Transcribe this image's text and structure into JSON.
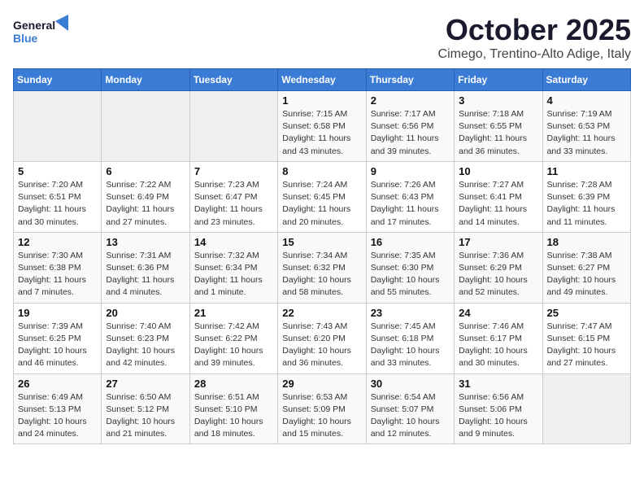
{
  "header": {
    "logo_general": "General",
    "logo_blue": "Blue",
    "title": "October 2025",
    "subtitle": "Cimego, Trentino-Alto Adige, Italy"
  },
  "weekdays": [
    "Sunday",
    "Monday",
    "Tuesday",
    "Wednesday",
    "Thursday",
    "Friday",
    "Saturday"
  ],
  "weeks": [
    [
      {
        "day": "",
        "info": ""
      },
      {
        "day": "",
        "info": ""
      },
      {
        "day": "",
        "info": ""
      },
      {
        "day": "1",
        "info": "Sunrise: 7:15 AM\nSunset: 6:58 PM\nDaylight: 11 hours and 43 minutes."
      },
      {
        "day": "2",
        "info": "Sunrise: 7:17 AM\nSunset: 6:56 PM\nDaylight: 11 hours and 39 minutes."
      },
      {
        "day": "3",
        "info": "Sunrise: 7:18 AM\nSunset: 6:55 PM\nDaylight: 11 hours and 36 minutes."
      },
      {
        "day": "4",
        "info": "Sunrise: 7:19 AM\nSunset: 6:53 PM\nDaylight: 11 hours and 33 minutes."
      }
    ],
    [
      {
        "day": "5",
        "info": "Sunrise: 7:20 AM\nSunset: 6:51 PM\nDaylight: 11 hours and 30 minutes."
      },
      {
        "day": "6",
        "info": "Sunrise: 7:22 AM\nSunset: 6:49 PM\nDaylight: 11 hours and 27 minutes."
      },
      {
        "day": "7",
        "info": "Sunrise: 7:23 AM\nSunset: 6:47 PM\nDaylight: 11 hours and 23 minutes."
      },
      {
        "day": "8",
        "info": "Sunrise: 7:24 AM\nSunset: 6:45 PM\nDaylight: 11 hours and 20 minutes."
      },
      {
        "day": "9",
        "info": "Sunrise: 7:26 AM\nSunset: 6:43 PM\nDaylight: 11 hours and 17 minutes."
      },
      {
        "day": "10",
        "info": "Sunrise: 7:27 AM\nSunset: 6:41 PM\nDaylight: 11 hours and 14 minutes."
      },
      {
        "day": "11",
        "info": "Sunrise: 7:28 AM\nSunset: 6:39 PM\nDaylight: 11 hours and 11 minutes."
      }
    ],
    [
      {
        "day": "12",
        "info": "Sunrise: 7:30 AM\nSunset: 6:38 PM\nDaylight: 11 hours and 7 minutes."
      },
      {
        "day": "13",
        "info": "Sunrise: 7:31 AM\nSunset: 6:36 PM\nDaylight: 11 hours and 4 minutes."
      },
      {
        "day": "14",
        "info": "Sunrise: 7:32 AM\nSunset: 6:34 PM\nDaylight: 11 hours and 1 minute."
      },
      {
        "day": "15",
        "info": "Sunrise: 7:34 AM\nSunset: 6:32 PM\nDaylight: 10 hours and 58 minutes."
      },
      {
        "day": "16",
        "info": "Sunrise: 7:35 AM\nSunset: 6:30 PM\nDaylight: 10 hours and 55 minutes."
      },
      {
        "day": "17",
        "info": "Sunrise: 7:36 AM\nSunset: 6:29 PM\nDaylight: 10 hours and 52 minutes."
      },
      {
        "day": "18",
        "info": "Sunrise: 7:38 AM\nSunset: 6:27 PM\nDaylight: 10 hours and 49 minutes."
      }
    ],
    [
      {
        "day": "19",
        "info": "Sunrise: 7:39 AM\nSunset: 6:25 PM\nDaylight: 10 hours and 46 minutes."
      },
      {
        "day": "20",
        "info": "Sunrise: 7:40 AM\nSunset: 6:23 PM\nDaylight: 10 hours and 42 minutes."
      },
      {
        "day": "21",
        "info": "Sunrise: 7:42 AM\nSunset: 6:22 PM\nDaylight: 10 hours and 39 minutes."
      },
      {
        "day": "22",
        "info": "Sunrise: 7:43 AM\nSunset: 6:20 PM\nDaylight: 10 hours and 36 minutes."
      },
      {
        "day": "23",
        "info": "Sunrise: 7:45 AM\nSunset: 6:18 PM\nDaylight: 10 hours and 33 minutes."
      },
      {
        "day": "24",
        "info": "Sunrise: 7:46 AM\nSunset: 6:17 PM\nDaylight: 10 hours and 30 minutes."
      },
      {
        "day": "25",
        "info": "Sunrise: 7:47 AM\nSunset: 6:15 PM\nDaylight: 10 hours and 27 minutes."
      }
    ],
    [
      {
        "day": "26",
        "info": "Sunrise: 6:49 AM\nSunset: 5:13 PM\nDaylight: 10 hours and 24 minutes."
      },
      {
        "day": "27",
        "info": "Sunrise: 6:50 AM\nSunset: 5:12 PM\nDaylight: 10 hours and 21 minutes."
      },
      {
        "day": "28",
        "info": "Sunrise: 6:51 AM\nSunset: 5:10 PM\nDaylight: 10 hours and 18 minutes."
      },
      {
        "day": "29",
        "info": "Sunrise: 6:53 AM\nSunset: 5:09 PM\nDaylight: 10 hours and 15 minutes."
      },
      {
        "day": "30",
        "info": "Sunrise: 6:54 AM\nSunset: 5:07 PM\nDaylight: 10 hours and 12 minutes."
      },
      {
        "day": "31",
        "info": "Sunrise: 6:56 AM\nSunset: 5:06 PM\nDaylight: 10 hours and 9 minutes."
      },
      {
        "day": "",
        "info": ""
      }
    ]
  ]
}
